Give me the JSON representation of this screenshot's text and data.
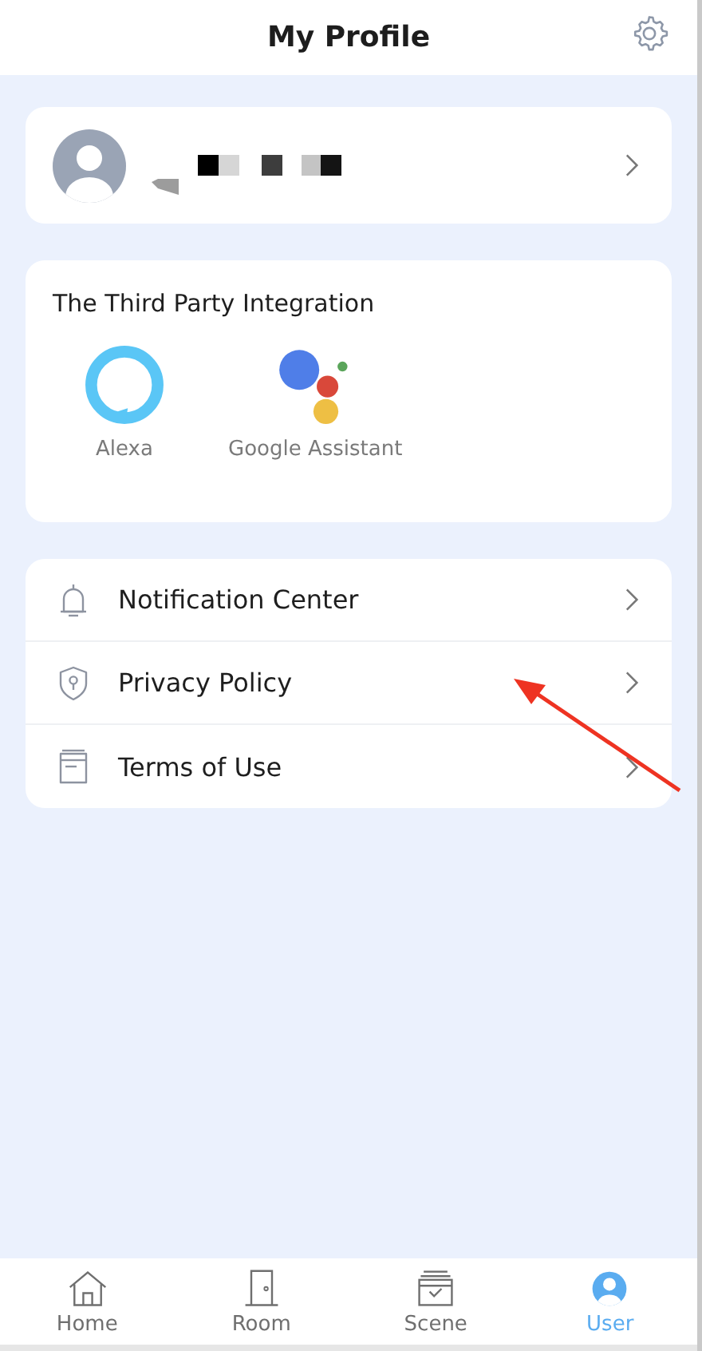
{
  "header": {
    "title": "My Profile"
  },
  "integration": {
    "title": "The Third Party Integration",
    "items": [
      {
        "kind": "alexa",
        "label": "Alexa"
      },
      {
        "kind": "google",
        "label": "Google Assistant"
      }
    ]
  },
  "menu": [
    {
      "kind": "bell",
      "label": "Notification Center"
    },
    {
      "kind": "shield",
      "label": "Privacy Policy"
    },
    {
      "kind": "document",
      "label": "Terms of Use"
    }
  ],
  "tabs": [
    {
      "kind": "home",
      "label": "Home",
      "selected": false
    },
    {
      "kind": "room",
      "label": "Room",
      "selected": false
    },
    {
      "kind": "scene",
      "label": "Scene",
      "selected": false
    },
    {
      "kind": "user",
      "label": "User",
      "selected": true
    }
  ]
}
